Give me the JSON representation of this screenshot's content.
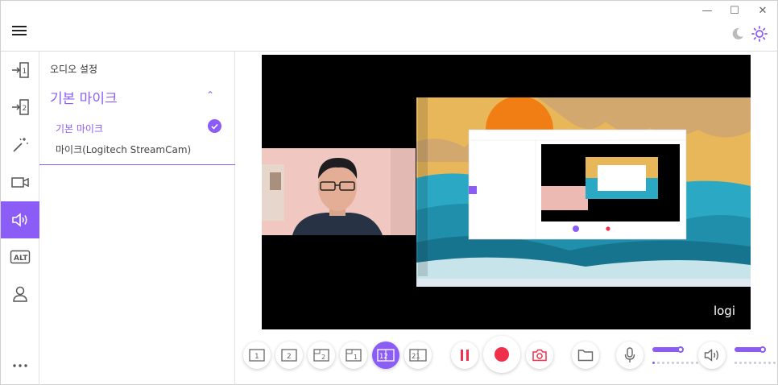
{
  "window": {
    "minimize_glyph": "—",
    "maximize_glyph": "☐",
    "close_glyph": "✕"
  },
  "panel": {
    "title": "오디오 설정",
    "section": "기본 마이크",
    "options": [
      {
        "label": "기본 마이크",
        "selected": true
      },
      {
        "label": "마이크(Logitech StreamCam)",
        "selected": false
      }
    ]
  },
  "rail": {
    "items": [
      {
        "icon": "source-1-icon"
      },
      {
        "icon": "source-2-icon"
      },
      {
        "icon": "effects-wand-icon"
      },
      {
        "icon": "video-camera-icon"
      },
      {
        "icon": "speaker-icon",
        "active": true
      },
      {
        "icon": "alt-icon",
        "label": "ALT"
      },
      {
        "icon": "user-icon"
      },
      {
        "icon": "more-icon"
      }
    ]
  },
  "preview": {
    "watermark": "logi"
  },
  "toolbar": {
    "layouts": [
      {
        "label": "1"
      },
      {
        "label": "2"
      },
      {
        "label": "2"
      },
      {
        "label": "1"
      },
      {
        "label": "12",
        "active": true
      },
      {
        "label": "21"
      }
    ],
    "mic_volume": 0.9,
    "speaker_volume": 0.9
  },
  "colors": {
    "accent": "#8b5cf6",
    "record": "#f0304a"
  }
}
